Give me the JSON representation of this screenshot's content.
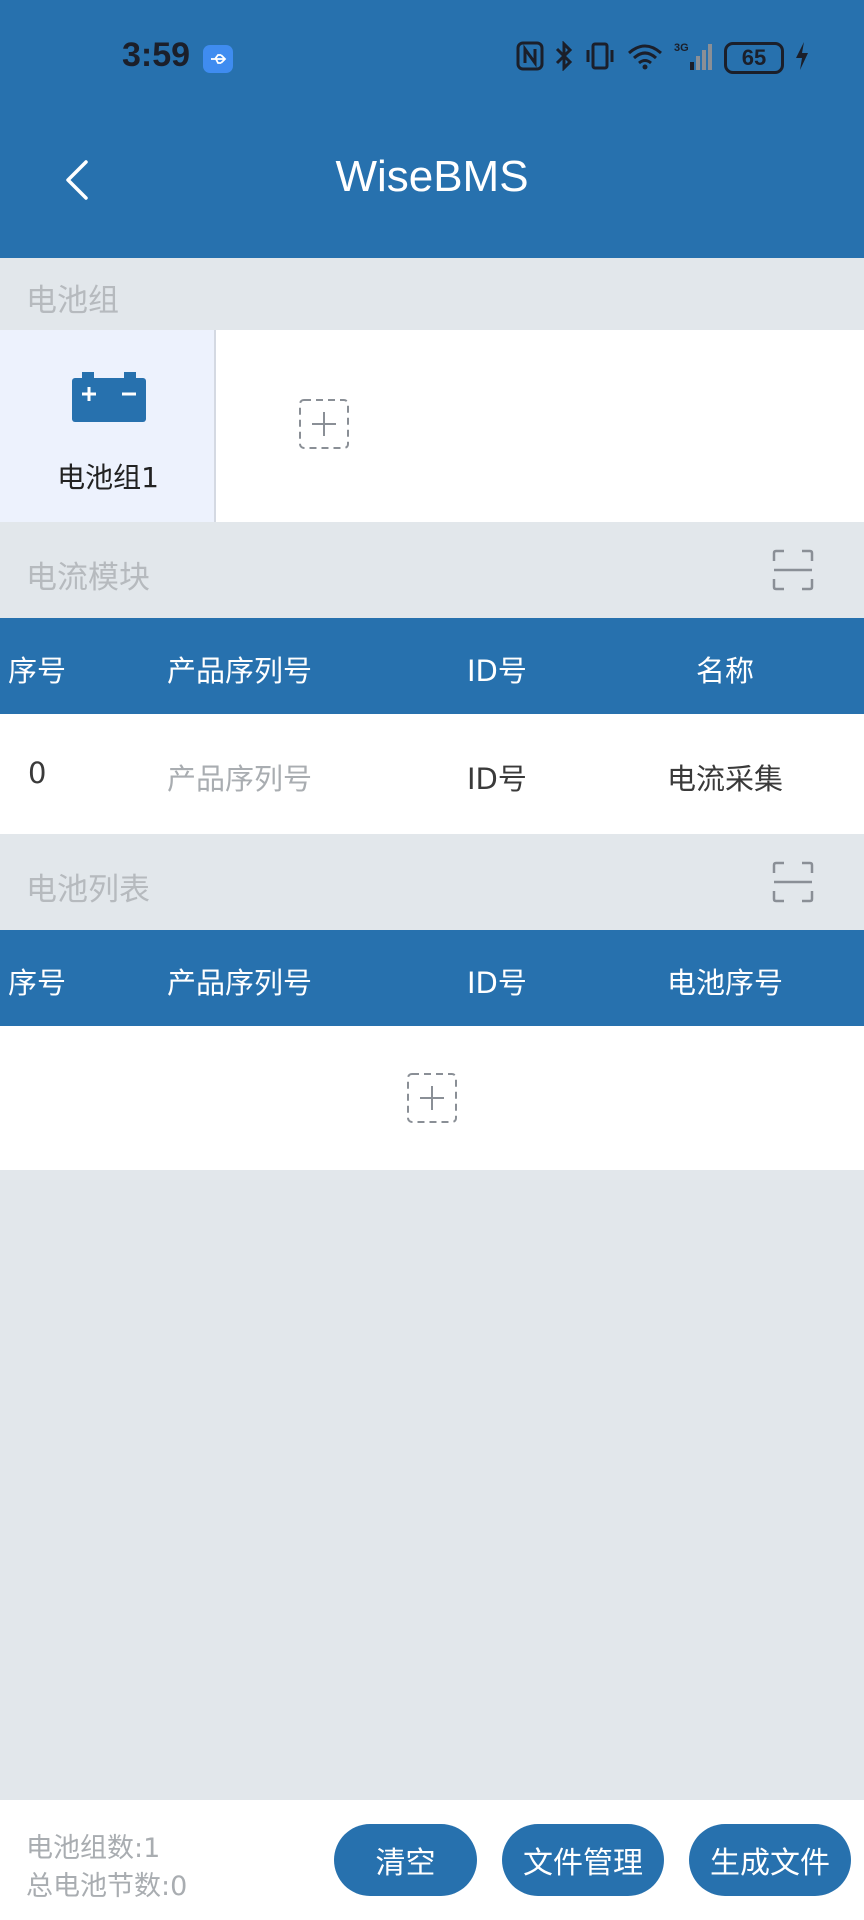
{
  "status_bar": {
    "time": "3:59",
    "network": "3G",
    "battery": "65"
  },
  "header": {
    "title": "WiseBMS"
  },
  "battery_group_section": {
    "label": "电池组",
    "groups": [
      {
        "name": "电池组1"
      }
    ]
  },
  "current_module_section": {
    "label": "电流模块",
    "columns": [
      "序号",
      "产品序列号",
      "ID号",
      "名称"
    ],
    "rows": [
      {
        "index": "0",
        "serial": "产品序列号",
        "id": "ID号",
        "name": "电流采集"
      }
    ]
  },
  "battery_list_section": {
    "label": "电池列表",
    "columns": [
      "序号",
      "产品序列号",
      "ID号",
      "电池序号"
    ]
  },
  "footer": {
    "group_count": "电池组数:1",
    "cell_count": "总电池节数:0",
    "clear_label": "清空",
    "file_manage_label": "文件管理",
    "generate_label": "生成文件"
  },
  "colors": {
    "primary": "#2771ae",
    "background": "#e2e7eb",
    "selected_tile": "#edf2fd"
  }
}
